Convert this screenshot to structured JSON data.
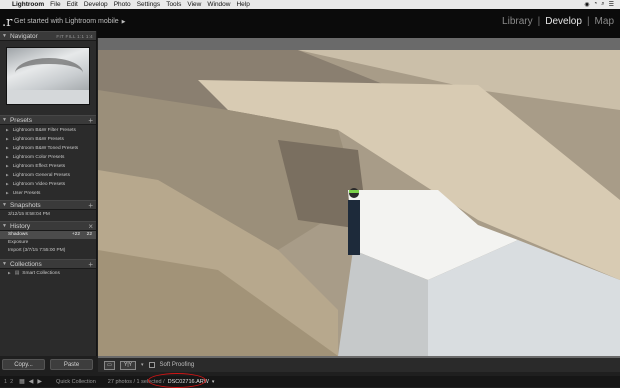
{
  "menubar": {
    "app": "Lightroom",
    "items": [
      "File",
      "Edit",
      "Develop",
      "Photo",
      "Settings",
      "Tools",
      "View",
      "Window",
      "Help"
    ]
  },
  "topbar": {
    "get_started": "Get started with Lightroom mobile",
    "modules": [
      "Library",
      "Develop",
      "Map"
    ],
    "active_module": "Develop"
  },
  "navigator": {
    "title": "Navigator",
    "zoom_options": "FIT  FILL  1:1  1:4"
  },
  "presets": {
    "title": "Presets",
    "items": [
      "Lightroom B&W Filter Presets",
      "Lightroom B&W Presets",
      "Lightroom B&W Toned Presets",
      "Lightroom Color Presets",
      "Lightroom Effect Presets",
      "Lightroom General Presets",
      "Lightroom Video Presets",
      "User Presets"
    ]
  },
  "snapshots": {
    "title": "Snapshots",
    "items": [
      "3/12/15 8:58:04 PM"
    ]
  },
  "history": {
    "title": "History",
    "items": [
      {
        "label": "Shadows",
        "v1": "+22",
        "v2": "22"
      },
      {
        "label": "Exposure",
        "v1": "",
        "v2": ""
      },
      {
        "label": "Import (3/7/15 7:55:00 PM)",
        "v1": "",
        "v2": ""
      }
    ]
  },
  "collections": {
    "title": "Collections",
    "items": [
      "Smart Collections"
    ]
  },
  "buttons": {
    "copy": "Copy...",
    "paste": "Paste"
  },
  "toolbar": {
    "view_before_after": "Y|Y",
    "soft_proofing": "Soft Proofing"
  },
  "filmstrip": {
    "page_a": "1",
    "page_b": "2",
    "source": "Quick Collection",
    "count": "27 photos / 1 selected /",
    "filename": "DSC02716.ARW"
  }
}
